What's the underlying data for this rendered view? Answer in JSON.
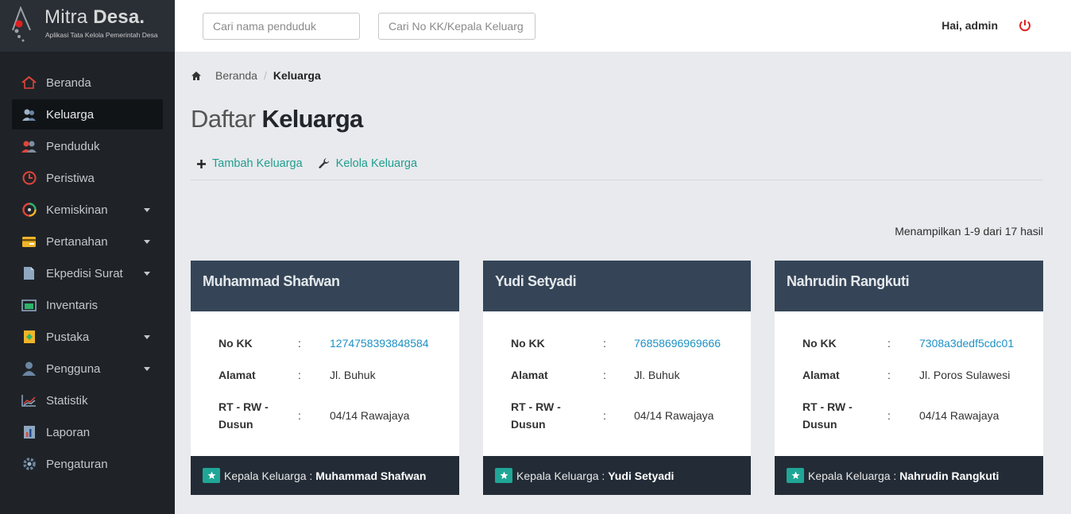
{
  "brand": {
    "name_light": "Mitra ",
    "name_bold": "Desa.",
    "tagline": "Aplikasi Tata Kelola Pemerintah Desa"
  },
  "sidebar": {
    "items": [
      {
        "label": "Beranda",
        "icon": "home-icon",
        "has_caret": false,
        "active": false
      },
      {
        "label": "Keluarga",
        "icon": "family-icon",
        "has_caret": false,
        "active": true
      },
      {
        "label": "Penduduk",
        "icon": "people-icon",
        "has_caret": false,
        "active": false
      },
      {
        "label": "Peristiwa",
        "icon": "clock-icon",
        "has_caret": false,
        "active": false
      },
      {
        "label": "Kemiskinan",
        "icon": "pie-icon",
        "has_caret": true,
        "active": false
      },
      {
        "label": "Pertanahan",
        "icon": "card-icon",
        "has_caret": true,
        "active": false
      },
      {
        "label": "Ekpedisi Surat",
        "icon": "document-icon",
        "has_caret": true,
        "active": false
      },
      {
        "label": "Inventaris",
        "icon": "folder-icon",
        "has_caret": false,
        "active": false
      },
      {
        "label": "Pustaka",
        "icon": "book-icon",
        "has_caret": true,
        "active": false
      },
      {
        "label": "Pengguna",
        "icon": "user-icon",
        "has_caret": true,
        "active": false
      },
      {
        "label": "Statistik",
        "icon": "chart-icon",
        "has_caret": false,
        "active": false
      },
      {
        "label": "Laporan",
        "icon": "report-icon",
        "has_caret": false,
        "active": false
      },
      {
        "label": "Pengaturan",
        "icon": "gear-icon",
        "has_caret": false,
        "active": false
      }
    ]
  },
  "topbar": {
    "search_penduduk_placeholder": "Cari nama penduduk",
    "search_kk_placeholder": "Cari No KK/Kepala Keluarg",
    "greeting": "Hai, admin"
  },
  "breadcrumb": {
    "home": "Beranda",
    "current": "Keluarga"
  },
  "page": {
    "title_light": "Daftar ",
    "title_bold": "Keluarga",
    "action_add": "Tambah Keluarga",
    "action_manage": "Kelola Keluarga",
    "result_info": "Menampilkan 1-9 dari 17 hasil"
  },
  "labels": {
    "no_kk": "No KK",
    "alamat": "Alamat",
    "rt_rw_line1": "RT - RW -",
    "rt_rw_line2": "Dusun",
    "colon": ":",
    "kepala": "Kepala Keluarga : "
  },
  "cards": [
    {
      "name": "Muhammad Shafwan",
      "no_kk": "1274758393848584",
      "alamat": "Jl. Buhuk",
      "rt_rw": "04/14 Rawajaya",
      "kepala": "Muhammad Shafwan"
    },
    {
      "name": "Yudi Setyadi",
      "no_kk": "76858696969666",
      "alamat": "Jl. Buhuk",
      "rt_rw": "04/14 Rawajaya",
      "kepala": "Yudi Setyadi"
    },
    {
      "name": "Nahrudin Rangkuti",
      "no_kk": "7308a3dedf5cdc01",
      "alamat": "Jl. Poros Sulawesi",
      "rt_rw": "04/14 Rawajaya",
      "kepala": "Nahrudin Rangkuti"
    }
  ],
  "colors": {
    "sidebar_bg": "#1f2328",
    "accent_teal": "#1f9e8f",
    "card_header": "#354557",
    "card_footer": "#232c36",
    "link_blue": "#1d91c4",
    "power_red": "#e02020"
  }
}
